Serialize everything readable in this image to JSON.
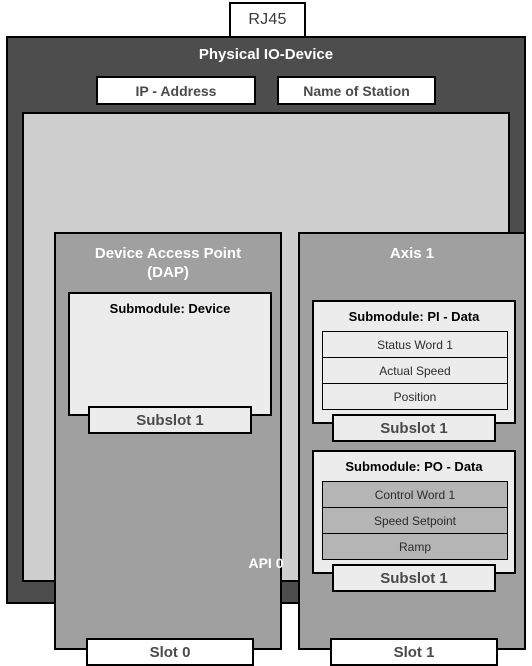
{
  "connector": {
    "label": "RJ45"
  },
  "device": {
    "title": "Physical IO-Device",
    "ip_address_label": "IP - Address",
    "station_name_label": "Name of Station"
  },
  "api": {
    "label": "API 0"
  },
  "slots": [
    {
      "title_line1": "Device Access Point",
      "title_line2": "(DAP)",
      "slot_label": "Slot 0",
      "submodules": [
        {
          "title": "Submodule: Device",
          "rows": [],
          "row_style": "light",
          "subslot_label": "Subslot 1"
        }
      ]
    },
    {
      "title_line1": "Axis 1",
      "title_line2": "",
      "slot_label": "Slot 1",
      "submodules": [
        {
          "title": "Submodule: PI - Data",
          "rows": [
            "Status Word 1",
            "Actual Speed",
            "Position"
          ],
          "row_style": "light",
          "subslot_label": "Subslot 1"
        },
        {
          "title": "Submodule: PO - Data",
          "rows": [
            "Control Word 1",
            "Speed Setpoint",
            "Ramp"
          ],
          "row_style": "dark",
          "subslot_label": "Subslot 1"
        }
      ]
    }
  ],
  "colors": {
    "device_frame": "#4d4d4d",
    "api_background": "#cfcfcf",
    "slot_background": "#a0a0a0",
    "submodule_background": "#ececec",
    "row_light": "#ececec",
    "row_dark": "#b5b5b5",
    "tab_white": "#ffffff",
    "text_dark": "#4a4a4a",
    "text_white": "#ffffff"
  }
}
